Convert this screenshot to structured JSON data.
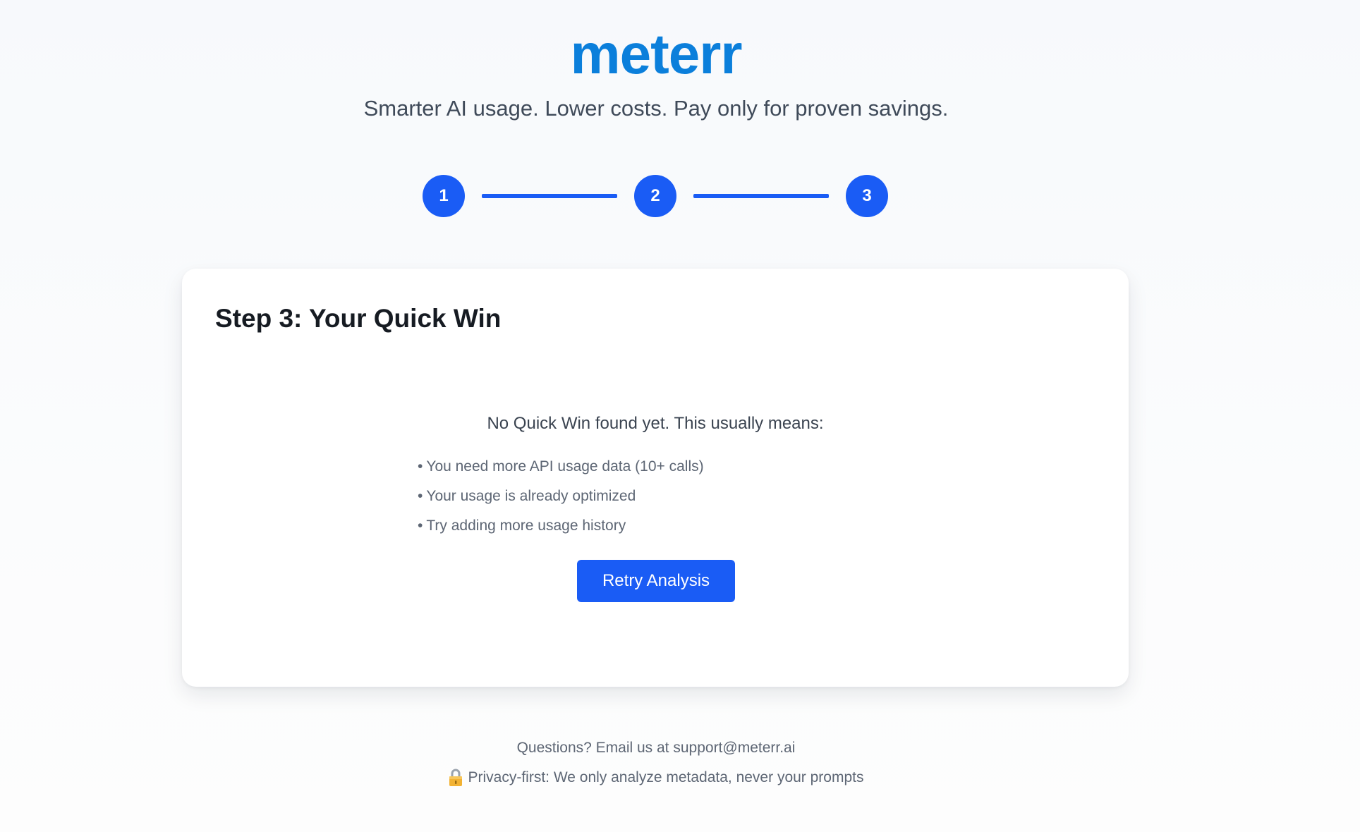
{
  "brand": {
    "name": "meterr",
    "tagline": "Smarter AI usage. Lower costs. Pay only for proven savings.",
    "accent_color": "#0b7fdb"
  },
  "stepper": {
    "steps": [
      {
        "number": "1",
        "state": "complete"
      },
      {
        "number": "2",
        "state": "complete"
      },
      {
        "number": "3",
        "state": "active"
      }
    ],
    "color": "#1a5cf5"
  },
  "card": {
    "title": "Step 3: Your Quick Win",
    "intro": "No Quick Win found yet. This usually means:",
    "reasons": [
      "You need more API usage data (10+ calls)",
      "Your usage is already optimized",
      "Try adding more usage history"
    ],
    "bullet": "•",
    "retry_label": "Retry Analysis"
  },
  "footer": {
    "contact": "Questions? Email us at support@meterr.ai",
    "privacy": "Privacy-first: We only analyze metadata, never your prompts",
    "privacy_icon": "lock-icon"
  }
}
